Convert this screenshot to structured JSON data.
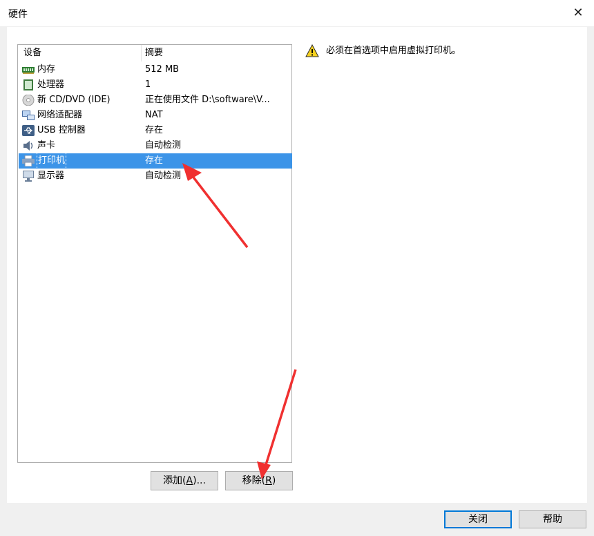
{
  "window": {
    "title": "硬件",
    "close_glyph": "✕"
  },
  "device_list": {
    "columns": [
      "设备",
      "摘要"
    ],
    "rows": [
      {
        "device": "内存",
        "summary": "512 MB",
        "icon": "memory-icon"
      },
      {
        "device": "处理器",
        "summary": "1",
        "icon": "processor-icon"
      },
      {
        "device": "新 CD/DVD (IDE)",
        "summary": "正在使用文件 D:\\software\\V...",
        "icon": "cd-dvd-icon"
      },
      {
        "device": "网络适配器",
        "summary": "NAT",
        "icon": "network-adapter-icon"
      },
      {
        "device": "USB 控制器",
        "summary": "存在",
        "icon": "usb-icon"
      },
      {
        "device": "声卡",
        "summary": "自动检测",
        "icon": "speaker-icon"
      },
      {
        "device": "打印机",
        "summary": "存在",
        "icon": "printer-icon",
        "selected": true
      },
      {
        "device": "显示器",
        "summary": "自动检测",
        "icon": "monitor-icon"
      }
    ]
  },
  "buttons": {
    "add_prefix": "添加(",
    "add_key": "A",
    "add_suffix": ")...",
    "remove_prefix": "移除(",
    "remove_key": "R",
    "remove_suffix": ")",
    "close": "关闭",
    "help": "帮助"
  },
  "info": {
    "message": "必须在首选项中启用虚拟打印机。",
    "icon": "warning-icon"
  },
  "colors": {
    "selection": "#3c94e8",
    "annotation_arrow": "#f03030"
  }
}
